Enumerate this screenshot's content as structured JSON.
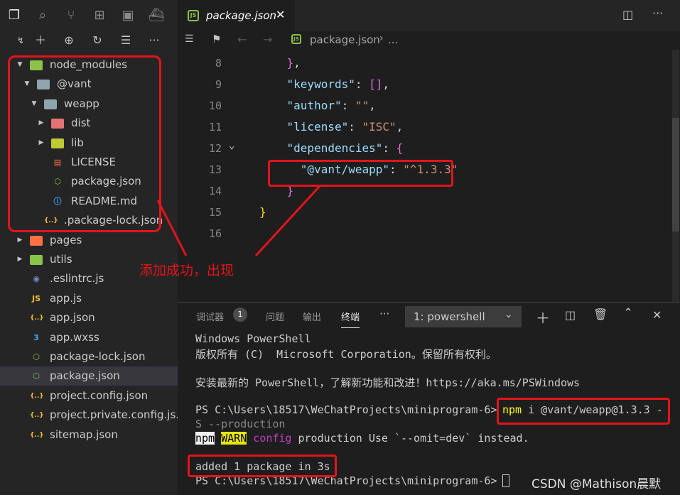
{
  "sidebar": {
    "tree": [
      {
        "label": "node_modules",
        "depth": 0,
        "expanded": true,
        "type": "folder",
        "color": "#8bc34a"
      },
      {
        "label": "@vant",
        "depth": 1,
        "expanded": true,
        "type": "folder",
        "color": "#90a4ae"
      },
      {
        "label": "weapp",
        "depth": 2,
        "expanded": true,
        "type": "folder",
        "color": "#90a4ae"
      },
      {
        "label": "dist",
        "depth": 3,
        "expanded": false,
        "type": "folder",
        "color": "#e57373"
      },
      {
        "label": "lib",
        "depth": 3,
        "expanded": false,
        "type": "folder",
        "color": "#c0ca33"
      },
      {
        "label": "LICENSE",
        "depth": 3,
        "type": "file",
        "icon": "license-icon",
        "color": "#ff7043"
      },
      {
        "label": "package.json",
        "depth": 3,
        "type": "file",
        "icon": "nodejs-icon",
        "color": "#8bc34a"
      },
      {
        "label": "README.md",
        "depth": 3,
        "type": "file",
        "icon": "info-icon",
        "color": "#42a5f5"
      },
      {
        "label": ".package-lock.json",
        "depth": 2,
        "type": "file",
        "icon": "json-icon",
        "color": "#fbc02d"
      },
      {
        "label": "pages",
        "depth": 0,
        "expanded": false,
        "type": "folder",
        "color": "#ff7043"
      },
      {
        "label": "utils",
        "depth": 0,
        "expanded": false,
        "type": "folder",
        "color": "#8bc34a"
      },
      {
        "label": ".eslintrc.js",
        "depth": 0,
        "type": "file",
        "icon": "eslint-icon",
        "color": "#7986cb"
      },
      {
        "label": "app.js",
        "depth": 0,
        "type": "file",
        "icon": "js-icon",
        "color": "#fbc02d"
      },
      {
        "label": "app.json",
        "depth": 0,
        "type": "file",
        "icon": "json-icon",
        "color": "#fbc02d"
      },
      {
        "label": "app.wxss",
        "depth": 0,
        "type": "file",
        "icon": "css-icon",
        "color": "#42a5f5"
      },
      {
        "label": "package-lock.json",
        "depth": 0,
        "type": "file",
        "icon": "nodejs-icon",
        "color": "#8bc34a"
      },
      {
        "label": "package.json",
        "depth": 0,
        "type": "file",
        "icon": "nodejs-icon",
        "color": "#8bc34a",
        "selected": true
      },
      {
        "label": "project.config.json",
        "depth": 0,
        "type": "file",
        "icon": "json-icon",
        "color": "#fbc02d"
      },
      {
        "label": "project.private.config.js...",
        "depth": 0,
        "type": "file",
        "icon": "json-icon",
        "color": "#fbc02d"
      },
      {
        "label": "sitemap.json",
        "depth": 0,
        "type": "file",
        "icon": "json-icon",
        "color": "#fbc02d"
      }
    ]
  },
  "editor": {
    "tab_label": "package.json",
    "breadcrumb_file": "package.json",
    "breadcrumb_more": "...",
    "lines": [
      {
        "n": "8",
        "parts": [
          [
            "p",
            "    "
          ],
          [
            "b1",
            "}"
          ],
          [
            "p",
            ","
          ]
        ]
      },
      {
        "n": "9",
        "parts": [
          [
            "p",
            "    "
          ],
          [
            "k",
            "\"keywords\""
          ],
          [
            "p",
            ": "
          ],
          [
            "b1",
            "[]"
          ],
          [
            "p",
            ","
          ]
        ]
      },
      {
        "n": "10",
        "parts": [
          [
            "p",
            "    "
          ],
          [
            "k",
            "\"author\""
          ],
          [
            "p",
            ": "
          ],
          [
            "s",
            "\"\""
          ],
          [
            "p",
            ","
          ]
        ]
      },
      {
        "n": "11",
        "parts": [
          [
            "p",
            "    "
          ],
          [
            "k",
            "\"license\""
          ],
          [
            "p",
            ": "
          ],
          [
            "s",
            "\"ISC\""
          ],
          [
            "p",
            ","
          ]
        ]
      },
      {
        "n": "12",
        "parts": [
          [
            "p",
            "    "
          ],
          [
            "k",
            "\"dependencies\""
          ],
          [
            "p",
            ": "
          ],
          [
            "b1",
            "{"
          ]
        ]
      },
      {
        "n": "13",
        "parts": [
          [
            "p",
            "      "
          ],
          [
            "k",
            "\"@vant/weapp\""
          ],
          [
            "p",
            ": "
          ],
          [
            "s",
            "\"^1.3.3\""
          ]
        ]
      },
      {
        "n": "14",
        "parts": [
          [
            "p",
            "    "
          ],
          [
            "b1",
            "}"
          ]
        ]
      },
      {
        "n": "15",
        "parts": [
          [
            "b2",
            "}"
          ]
        ]
      },
      {
        "n": "16",
        "parts": []
      }
    ],
    "annotation": "添加成功，出现"
  },
  "panel": {
    "tabs": [
      "调试器",
      "问题",
      "输出",
      "终端"
    ],
    "debug_badge": "1",
    "more": "···",
    "terminal_select": "1: powershell",
    "terminal_lines": [
      "Windows PowerShell",
      "版权所有 (C)  Microsoft Corporation。保留所有权利。",
      "",
      "安装最新的 PowerShell，了解新功能和改进！https://aka.ms/PSWindows",
      "",
      "PS C:\\Users\\18517\\WeChatProjects\\miniprogram-6> ",
      "S --production",
      "",
      "",
      "added 1 package in 3s",
      "PS C:\\Users\\18517\\WeChatProjects\\miniprogram-6> "
    ],
    "cmd_npm": "npm",
    "cmd_rest": " i @vant/weapp@1.3.3 -",
    "warn_npm": "npm",
    "warn_tag": "WARN",
    "warn_config": "config",
    "warn_text": " production Use `--omit=dev` instead.",
    "watermark": "CSDN @Mathison晨默"
  },
  "colors": {
    "annotation_red": "#e3141b",
    "selected_row": "#37373d"
  }
}
